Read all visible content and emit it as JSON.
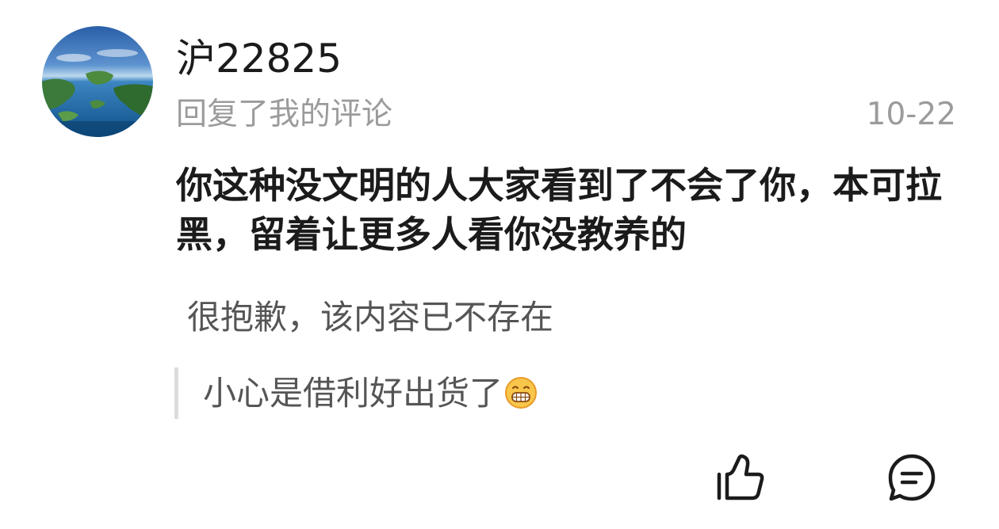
{
  "comment": {
    "username": "沪22825",
    "subtitle": "回复了我的评论",
    "timestamp": "10-22",
    "reply_text": "你这种没文明的人大家看到了不会了你，本可拉黑，留着让更多人看你没教养的",
    "deleted_notice": "很抱歉，该内容已不存在",
    "quoted_comment": "小心是借利好出货了",
    "quoted_emoji": "grinning-face-emoji",
    "avatar_icon": "island-landscape-avatar"
  },
  "actions": {
    "like_icon": "thumbs-up-icon",
    "reply_icon": "comment-bubble-icon"
  },
  "colors": {
    "primary_text": "#1b1b1b",
    "secondary_text": "#9b9b9b",
    "muted_text": "#555555",
    "quote_bar": "#dcdcdc",
    "background": "#ffffff"
  }
}
